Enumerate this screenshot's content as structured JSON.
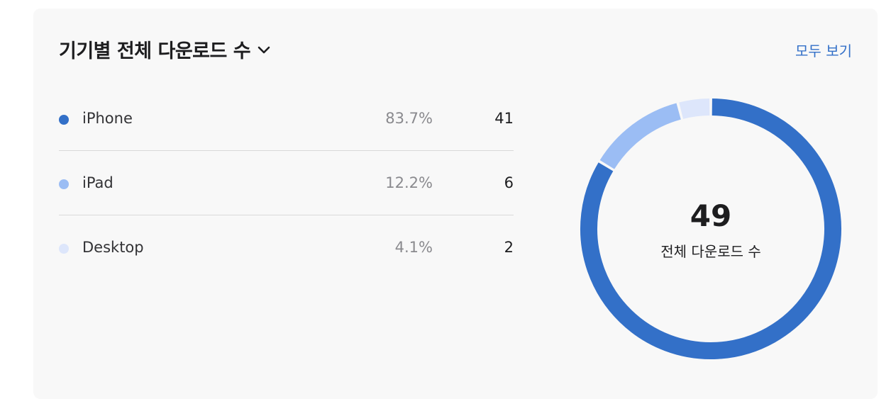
{
  "card": {
    "title": "기기별 전체 다운로드 수",
    "see_all_label": "모두 보기"
  },
  "devices": [
    {
      "label": "iPhone",
      "percent": "83.7%",
      "count": "41",
      "value": 41,
      "color": "#3370c8"
    },
    {
      "label": "iPad",
      "percent": "12.2%",
      "count": "6",
      "value": 6,
      "color": "#9bbdf4"
    },
    {
      "label": "Desktop",
      "percent": "4.1%",
      "count": "2",
      "value": 2,
      "color": "#dde6fb"
    }
  ],
  "summary": {
    "total": "49",
    "total_label": "전체 다운로드 수"
  },
  "chart_data": {
    "type": "pie",
    "categories": [
      "iPhone",
      "iPad",
      "Desktop"
    ],
    "values": [
      41,
      6,
      2
    ]
  },
  "icons": {
    "title_chevron": "chevron-down-icon"
  }
}
